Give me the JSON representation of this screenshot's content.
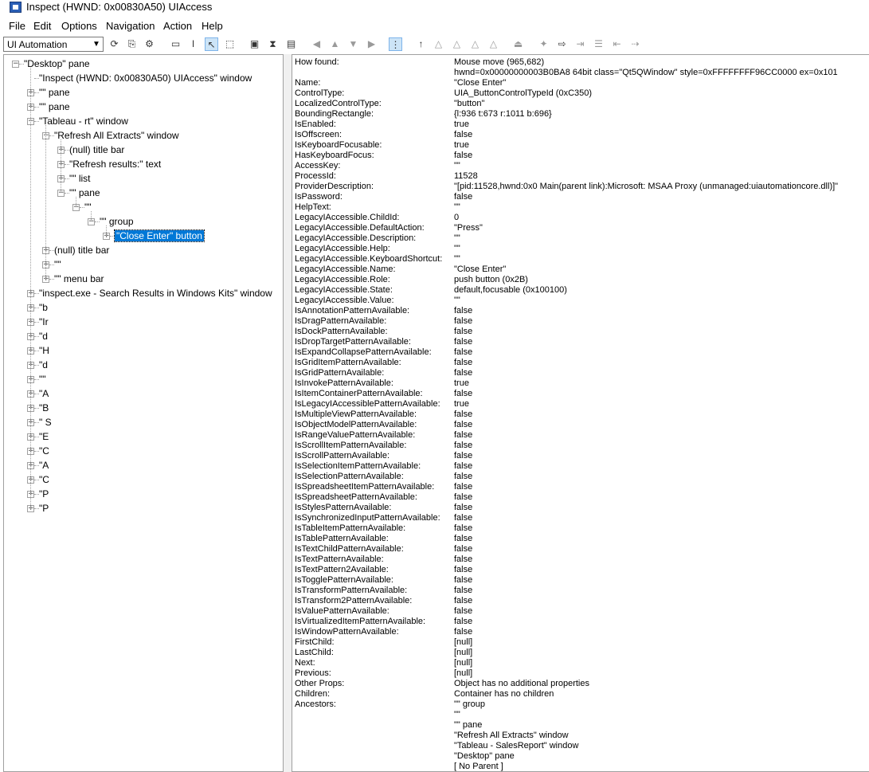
{
  "window": {
    "title": "Inspect  (HWND: 0x00830A50) UIAccess"
  },
  "menu": [
    "File",
    "Edit",
    "Options",
    "Navigation",
    "Action",
    "Help"
  ],
  "toolbar": {
    "mode": "UI Automation"
  },
  "tree": [
    {
      "label": "\"Desktop\" pane",
      "level": 0,
      "exp": "-"
    },
    {
      "label": "\"Inspect  (HWND: 0x00830A50) UIAccess\" window",
      "level": 1,
      "exp": ""
    },
    {
      "label": "\"\" pane",
      "level": 1,
      "exp": "+"
    },
    {
      "label": "\"\" pane",
      "level": 1,
      "exp": "+"
    },
    {
      "label": "\"Tableau -                rt\" window",
      "level": 1,
      "exp": "-"
    },
    {
      "label": "\"Refresh All Extracts\" window",
      "level": 2,
      "exp": "-"
    },
    {
      "label": "(null) title bar",
      "level": 3,
      "exp": "+"
    },
    {
      "label": "\"Refresh results:\" text",
      "level": 3,
      "exp": "+"
    },
    {
      "label": "\"\" list",
      "level": 3,
      "exp": "+"
    },
    {
      "label": "\"\" pane",
      "level": 3,
      "exp": "-"
    },
    {
      "label": "\"\"",
      "level": 4,
      "exp": "-"
    },
    {
      "label": "\"\" group",
      "level": 5,
      "exp": "-"
    },
    {
      "label": "\"Close Enter\" button",
      "level": 6,
      "exp": "+",
      "selected": true
    },
    {
      "label": "(null) title bar",
      "level": 2,
      "exp": "+"
    },
    {
      "label": "\"\"",
      "level": 2,
      "exp": "+"
    },
    {
      "label": "\"\" menu bar",
      "level": 2,
      "exp": "+"
    },
    {
      "label": "\"inspect.exe - Search Results in Windows Kits\" window",
      "level": 1,
      "exp": "+"
    },
    {
      "label": "\"b",
      "level": 1,
      "exp": "+"
    },
    {
      "label": "\"Ir",
      "level": 1,
      "exp": "+"
    },
    {
      "label": "\"d",
      "level": 1,
      "exp": "+"
    },
    {
      "label": "\"H",
      "level": 1,
      "exp": "+"
    },
    {
      "label": "\"d",
      "level": 1,
      "exp": "+"
    },
    {
      "label": "\"\"",
      "level": 1,
      "exp": "+"
    },
    {
      "label": "\"A",
      "level": 1,
      "exp": "+"
    },
    {
      "label": "\"B",
      "level": 1,
      "exp": "+"
    },
    {
      "label": "\" S",
      "level": 1,
      "exp": "+"
    },
    {
      "label": "\"E",
      "level": 1,
      "exp": "+"
    },
    {
      "label": "\"C",
      "level": 1,
      "exp": "+"
    },
    {
      "label": "\"A",
      "level": 1,
      "exp": "+"
    },
    {
      "label": "\"C",
      "level": 1,
      "exp": "+"
    },
    {
      "label": "\"P",
      "level": 1,
      "exp": "+"
    },
    {
      "label": "\"P",
      "level": 1,
      "exp": "+"
    }
  ],
  "properties": [
    {
      "k": "How found:",
      "v": "Mouse move (965,682)"
    },
    {
      "k": "",
      "v": "hwnd=0x00000000003B0BA8 64bit class=\"Qt5QWindow\" style=0xFFFFFFFF96CC0000 ex=0x101"
    },
    {
      "k": "Name:",
      "v": "\"Close Enter\""
    },
    {
      "k": "ControlType:",
      "v": "UIA_ButtonControlTypeId (0xC350)"
    },
    {
      "k": "LocalizedControlType:",
      "v": "\"button\""
    },
    {
      "k": "BoundingRectangle:",
      "v": "{l:936 t:673 r:1011 b:696}"
    },
    {
      "k": "IsEnabled:",
      "v": "true"
    },
    {
      "k": "IsOffscreen:",
      "v": "false"
    },
    {
      "k": "IsKeyboardFocusable:",
      "v": "true"
    },
    {
      "k": "HasKeyboardFocus:",
      "v": "false"
    },
    {
      "k": "AccessKey:",
      "v": "\"\""
    },
    {
      "k": "ProcessId:",
      "v": "11528"
    },
    {
      "k": "ProviderDescription:",
      "v": "\"[pid:11528,hwnd:0x0 Main(parent link):Microsoft: MSAA Proxy (unmanaged:uiautomationcore.dll)]\""
    },
    {
      "k": "IsPassword:",
      "v": "false"
    },
    {
      "k": "HelpText:",
      "v": "\"\""
    },
    {
      "k": "LegacyIAccessible.ChildId:",
      "v": "0"
    },
    {
      "k": "LegacyIAccessible.DefaultAction:",
      "v": "\"Press\""
    },
    {
      "k": "LegacyIAccessible.Description:",
      "v": "\"\""
    },
    {
      "k": "LegacyIAccessible.Help:",
      "v": "\"\""
    },
    {
      "k": "LegacyIAccessible.KeyboardShortcut:",
      "v": "\"\""
    },
    {
      "k": "LegacyIAccessible.Name:",
      "v": "\"Close Enter\""
    },
    {
      "k": "LegacyIAccessible.Role:",
      "v": "push button (0x2B)"
    },
    {
      "k": "LegacyIAccessible.State:",
      "v": "default,focusable (0x100100)"
    },
    {
      "k": "LegacyIAccessible.Value:",
      "v": "\"\""
    },
    {
      "k": "IsAnnotationPatternAvailable:",
      "v": "false"
    },
    {
      "k": "IsDragPatternAvailable:",
      "v": "false"
    },
    {
      "k": "IsDockPatternAvailable:",
      "v": "false"
    },
    {
      "k": "IsDropTargetPatternAvailable:",
      "v": "false"
    },
    {
      "k": "IsExpandCollapsePatternAvailable:",
      "v": "false"
    },
    {
      "k": "IsGridItemPatternAvailable:",
      "v": "false"
    },
    {
      "k": "IsGridPatternAvailable:",
      "v": "false"
    },
    {
      "k": "IsInvokePatternAvailable:",
      "v": "true"
    },
    {
      "k": "IsItemContainerPatternAvailable:",
      "v": "false"
    },
    {
      "k": "IsLegacyIAccessiblePatternAvailable:",
      "v": "true"
    },
    {
      "k": "IsMultipleViewPatternAvailable:",
      "v": "false"
    },
    {
      "k": "IsObjectModelPatternAvailable:",
      "v": "false"
    },
    {
      "k": "IsRangeValuePatternAvailable:",
      "v": "false"
    },
    {
      "k": "IsScrollItemPatternAvailable:",
      "v": "false"
    },
    {
      "k": "IsScrollPatternAvailable:",
      "v": "false"
    },
    {
      "k": "IsSelectionItemPatternAvailable:",
      "v": "false"
    },
    {
      "k": "IsSelectionPatternAvailable:",
      "v": "false"
    },
    {
      "k": "IsSpreadsheetItemPatternAvailable:",
      "v": "false"
    },
    {
      "k": "IsSpreadsheetPatternAvailable:",
      "v": "false"
    },
    {
      "k": "IsStylesPatternAvailable:",
      "v": "false"
    },
    {
      "k": "IsSynchronizedInputPatternAvailable:",
      "v": "false"
    },
    {
      "k": "IsTableItemPatternAvailable:",
      "v": "false"
    },
    {
      "k": "IsTablePatternAvailable:",
      "v": "false"
    },
    {
      "k": "IsTextChildPatternAvailable:",
      "v": "false"
    },
    {
      "k": "IsTextPatternAvailable:",
      "v": "false"
    },
    {
      "k": "IsTextPattern2Available:",
      "v": "false"
    },
    {
      "k": "IsTogglePatternAvailable:",
      "v": "false"
    },
    {
      "k": "IsTransformPatternAvailable:",
      "v": "false"
    },
    {
      "k": "IsTransform2PatternAvailable:",
      "v": "false"
    },
    {
      "k": "IsValuePatternAvailable:",
      "v": "false"
    },
    {
      "k": "IsVirtualizedItemPatternAvailable:",
      "v": "false"
    },
    {
      "k": "IsWindowPatternAvailable:",
      "v": "false"
    },
    {
      "k": "FirstChild:",
      "v": "[null]"
    },
    {
      "k": "LastChild:",
      "v": "[null]"
    },
    {
      "k": "Next:",
      "v": "[null]"
    },
    {
      "k": "Previous:",
      "v": "[null]"
    },
    {
      "k": "Other Props:",
      "v": "Object has no additional properties"
    },
    {
      "k": "Children:",
      "v": "Container has no children"
    },
    {
      "k": "Ancestors:",
      "v": "\"\" group"
    },
    {
      "k": "",
      "v": "\"\""
    },
    {
      "k": "",
      "v": "\"\" pane"
    },
    {
      "k": "",
      "v": "\"Refresh All Extracts\" window"
    },
    {
      "k": "",
      "v": "\"Tableau - SalesReport\" window"
    },
    {
      "k": "",
      "v": "\"Desktop\" pane"
    },
    {
      "k": "",
      "v": "[ No Parent ]"
    }
  ]
}
